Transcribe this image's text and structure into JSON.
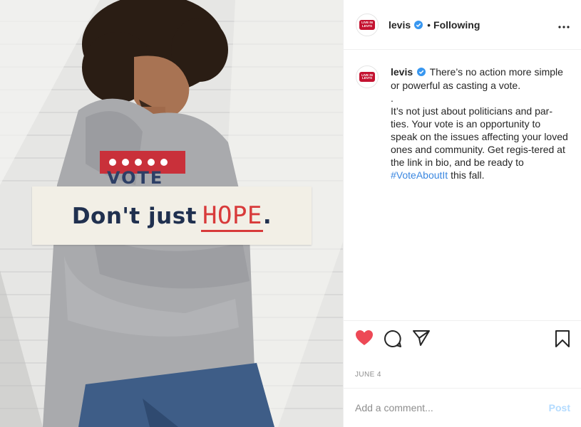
{
  "post": {
    "image_overlay": {
      "prefix": "Don't just",
      "emphasis": "HOPE",
      "suffix": "."
    },
    "hoodie_text": "VOTE"
  },
  "header": {
    "avatar_badge": "LIVE IN LEVI'S",
    "username": "levis",
    "separator": "•",
    "follow_status": "Following",
    "more_icon": "more-horizontal-icon"
  },
  "caption": {
    "username": "levis",
    "lines": [
      "There’s no action more simple or powerful as casting a vote.",
      ".",
      "It’s not just about politicians and par-ties. Your vote is an opportunity to speak on the issues affecting your loved ones and community. Get regis-tered at the link in bio, and be ready to"
    ],
    "hashtag": "#VoteAboutIt",
    "tail": " this fall."
  },
  "actions": {
    "like_icon": "heart-filled-icon",
    "comment_icon": "comment-icon",
    "share_icon": "share-icon",
    "save_icon": "bookmark-icon"
  },
  "date": "JUNE 4",
  "comment": {
    "placeholder": "Add a comment...",
    "post_label": "Post"
  },
  "colors": {
    "like": "#ed4956",
    "verified": "#3897f0",
    "hashtag": "#3a87e0",
    "post_disabled": "#b3dbff",
    "levis_red": "#c41230"
  }
}
